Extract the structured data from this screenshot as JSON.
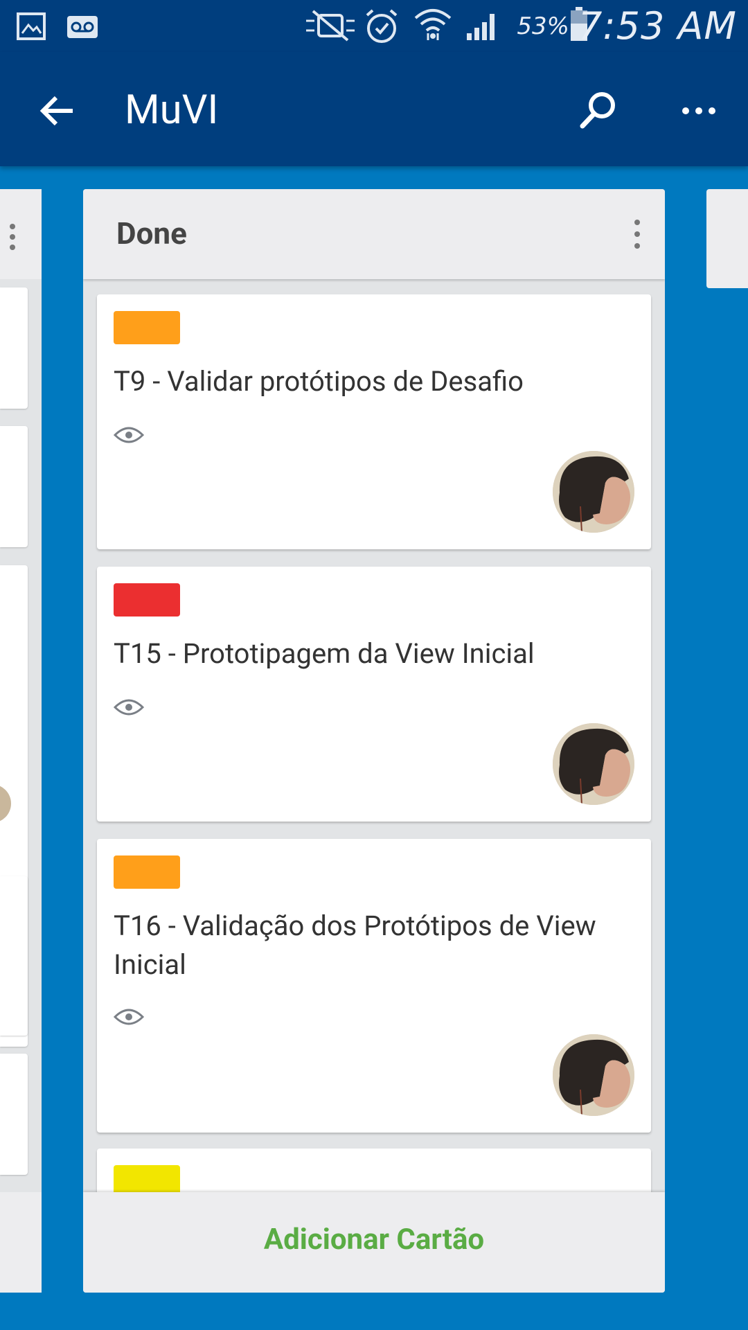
{
  "status_bar": {
    "battery_percent": "53%",
    "time": "7:53 AM",
    "icons": [
      "gallery-icon",
      "voicemail-icon",
      "mute-icon",
      "alarm-icon",
      "wifi-icon",
      "signal-icon",
      "battery-icon"
    ]
  },
  "app_bar": {
    "title": "MuVI",
    "icons": [
      "back-arrow-icon",
      "search-icon",
      "more-horizontal-icon"
    ]
  },
  "list": {
    "title": "Done",
    "add_card_label": "Adicionar Cartão",
    "cards": [
      {
        "label_color": "#ff9f1a",
        "title": "T9 - Validar protótipos de Desafio",
        "watching": true,
        "member": "avatar"
      },
      {
        "label_color": "#eb2f30",
        "title": "T15 - Prototipagem da View Inicial",
        "watching": true,
        "member": "avatar"
      },
      {
        "label_color": "#ff9f1a",
        "title": "T16 - Validação dos Protótipos de View Inicial",
        "watching": true,
        "member": "avatar"
      },
      {
        "label_color": "#f2e600"
      }
    ]
  },
  "colors": {
    "board_background": "#0079bf",
    "app_bar": "#003e7e",
    "add_card_text": "#5aac44"
  }
}
